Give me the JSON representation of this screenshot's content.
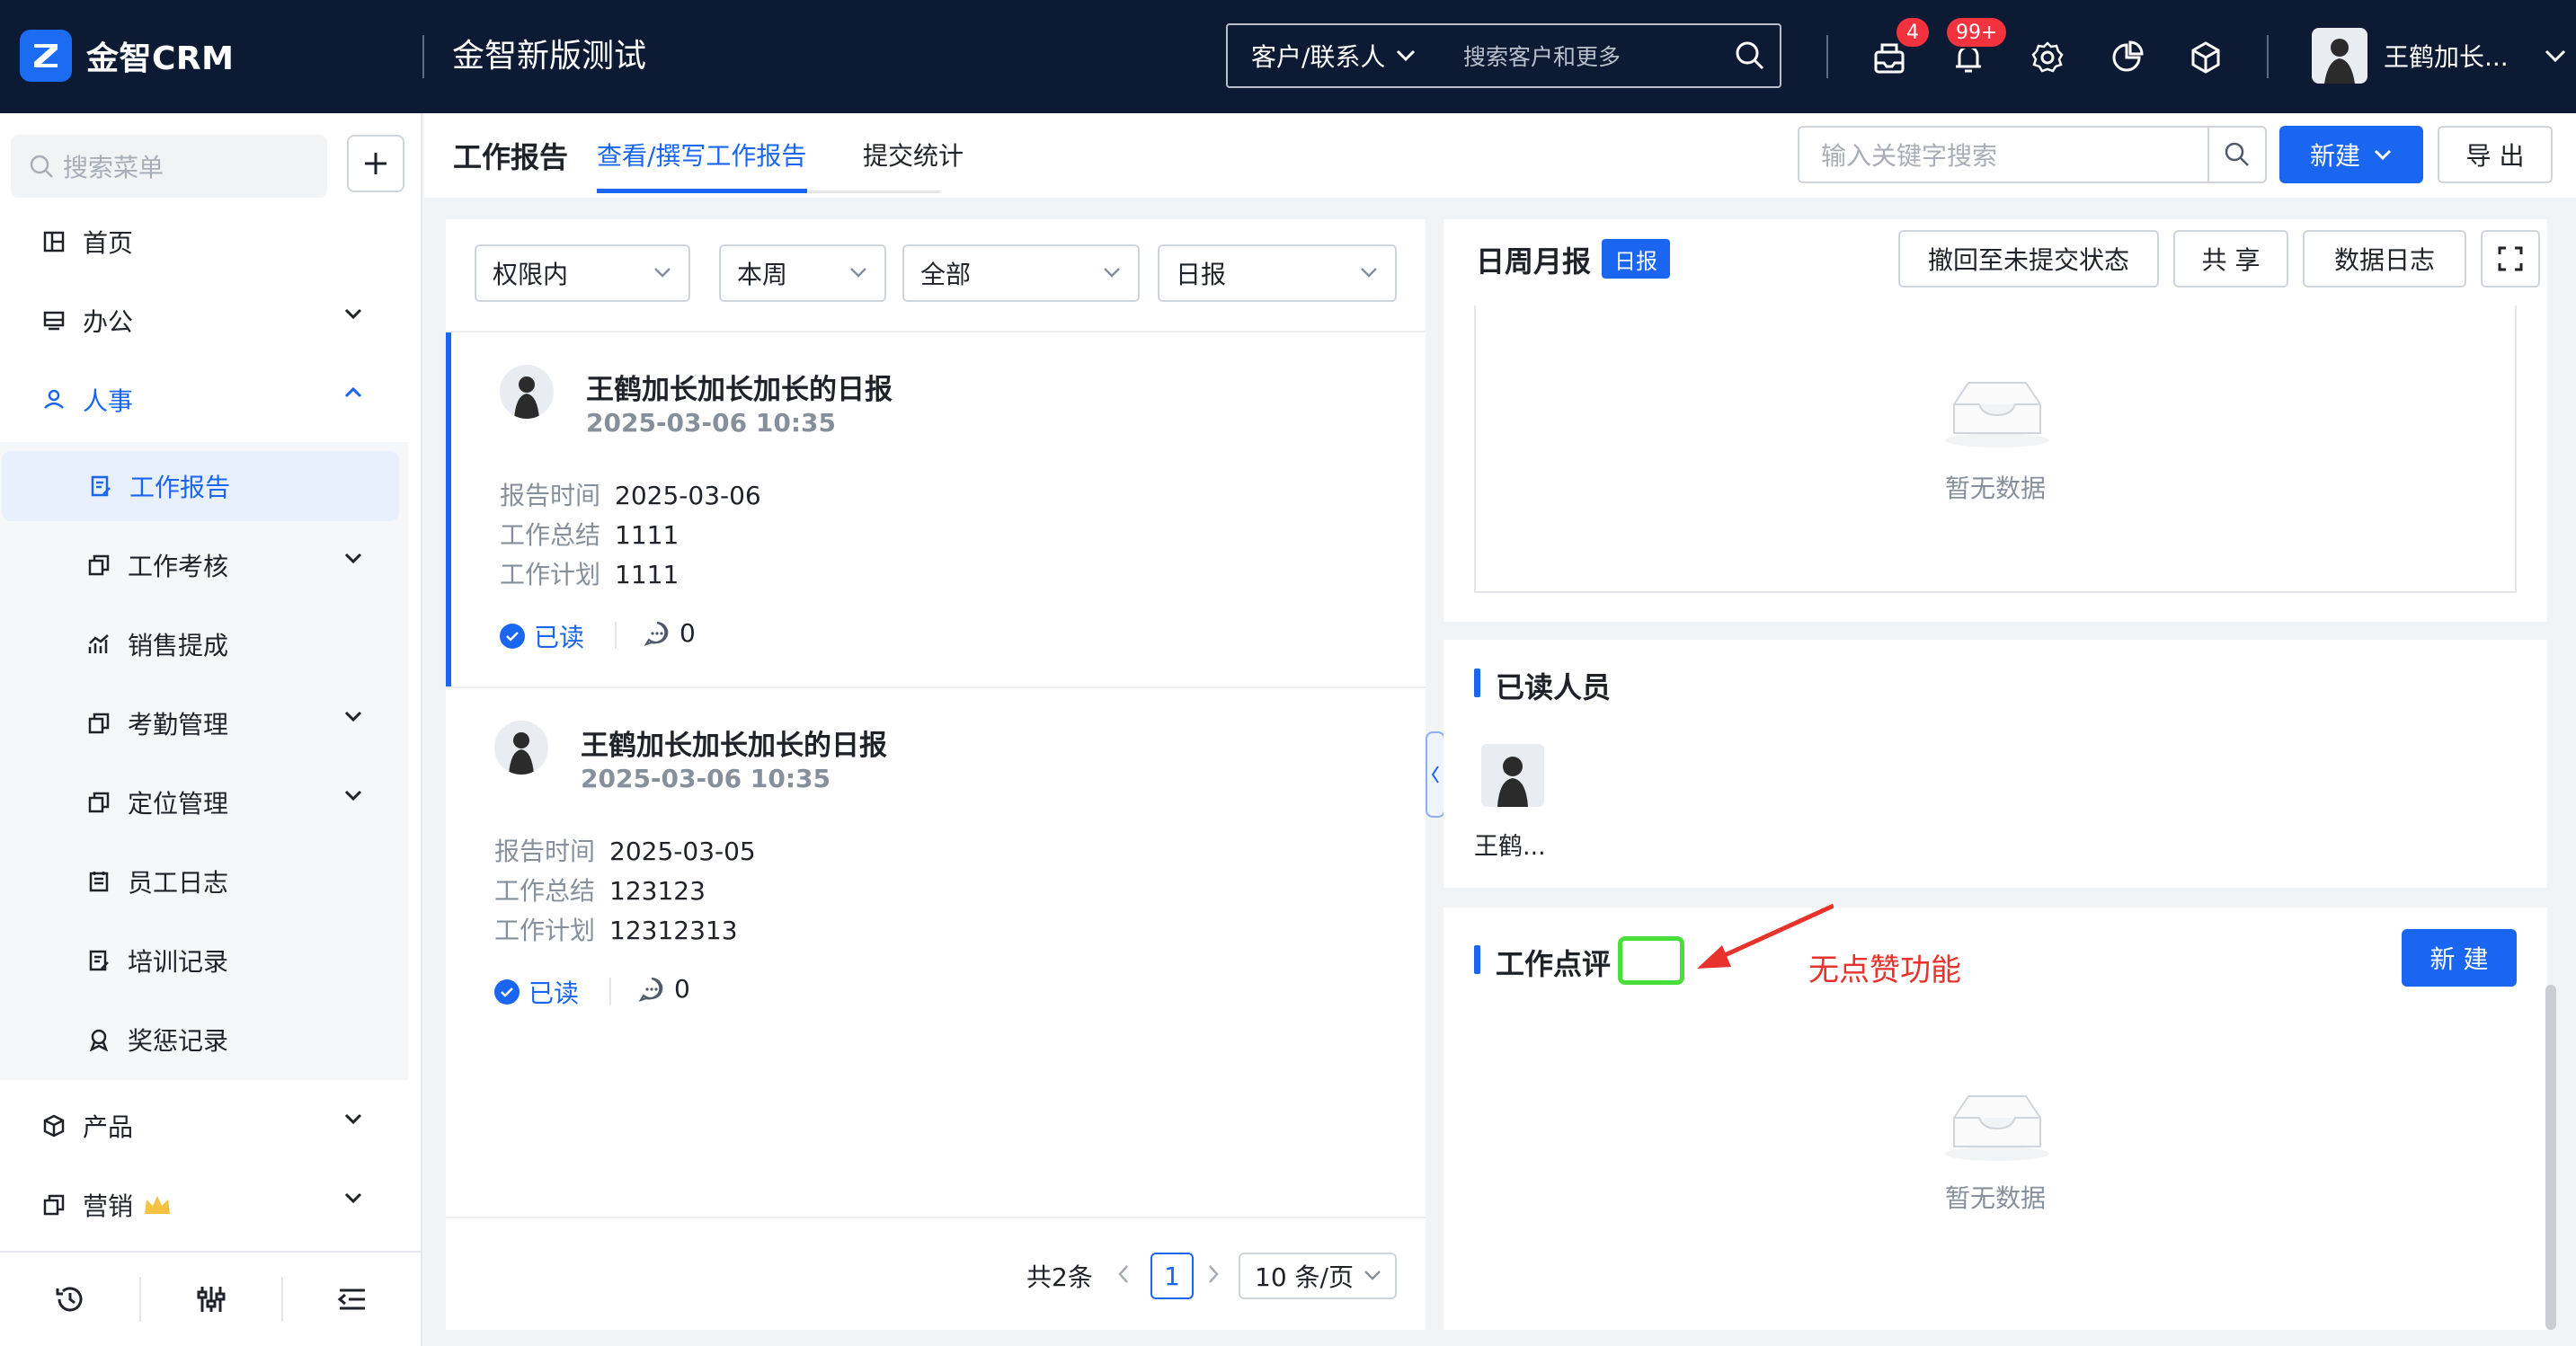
{
  "topbar": {
    "brand": "金智CRM",
    "org": "金智新版测试",
    "search_type": "客户/联系人",
    "search_placeholder": "搜索客户和更多",
    "msg_badge": "4",
    "notice_badge": "99+",
    "user_name": "王鹤加长..."
  },
  "sidebar": {
    "search_placeholder": "搜索菜单",
    "items": {
      "home": "首页",
      "office": "办公",
      "hr": "人事",
      "work_report": "工作报告",
      "appraisal": "工作考核",
      "commission": "销售提成",
      "attendance": "考勤管理",
      "location": "定位管理",
      "staff_log": "员工日志",
      "training": "培训记录",
      "reward": "奖惩记录",
      "product": "产品",
      "marketing": "营销"
    }
  },
  "header": {
    "title": "工作报告",
    "tabs": [
      "查看/撰写工作报告",
      "提交统计"
    ],
    "keyword_placeholder": "输入关键字搜索",
    "new_label": "新建",
    "export_label": "导 出"
  },
  "filters": [
    "权限内",
    "本周",
    "全部",
    "日报"
  ],
  "reports": [
    {
      "title": "王鹤加长加长加长的日报",
      "time": "2025-03-06 10:35",
      "report_time_label": "报告时间",
      "report_time": "2025-03-06",
      "summary_label": "工作总结",
      "summary": "1111",
      "plan_label": "工作计划",
      "plan": "1111",
      "read_label": "已读",
      "comments": "0"
    },
    {
      "title": "王鹤加长加长加长的日报",
      "time": "2025-03-06 10:35",
      "report_time_label": "报告时间",
      "report_time": "2025-03-05",
      "summary_label": "工作总结",
      "summary": "123123",
      "plan_label": "工作计划",
      "plan": "12312313",
      "read_label": "已读",
      "comments": "0"
    }
  ],
  "pagination": {
    "total": "共2条",
    "current": "1",
    "page_size": "10 条/页"
  },
  "detail": {
    "section_title": "日周月报",
    "type_tag": "日报",
    "revoke_label": "撤回至未提交状态",
    "share_label": "共 享",
    "datalog_label": "数据日志",
    "empty_text": "暂无数据",
    "readers_title": "已读人员",
    "reader_name": "王鹤...",
    "review_title": "工作点评",
    "review_new_label": "新 建",
    "review_empty": "暂无数据",
    "annotation": "无点赞功能"
  },
  "colors": {
    "accent": "#1a66f0",
    "topbar": "#0c1a33",
    "badge": "#f2323c",
    "annotation": "#e8322c",
    "highlight": "#4ade3a"
  }
}
